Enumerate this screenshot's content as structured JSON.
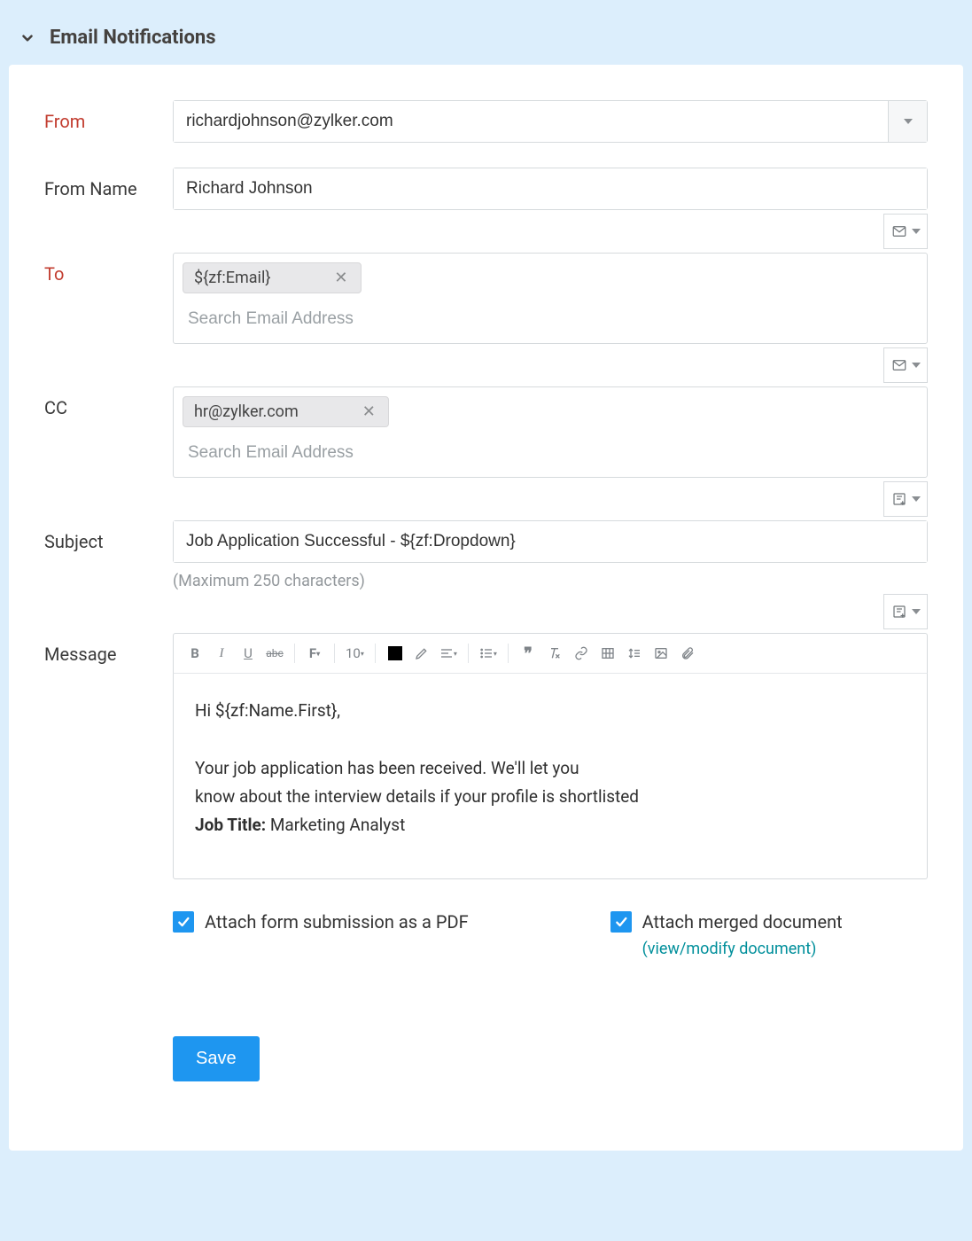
{
  "section_title": "Email Notifications",
  "labels": {
    "from": "From",
    "from_name": "From Name",
    "to": "To",
    "cc": "CC",
    "subject": "Subject",
    "message": "Message"
  },
  "from": {
    "value": "richardjohnson@zylker.com"
  },
  "from_name": {
    "value": "Richard Johnson"
  },
  "to": {
    "chip": "${zf:Email}",
    "placeholder": "Search Email Address"
  },
  "cc": {
    "chip": "hr@zylker.com",
    "placeholder": "Search Email Address"
  },
  "subject": {
    "value": "Job Application Successful - ${zf:Dropdown}",
    "hint": "(Maximum 250 characters)"
  },
  "message": {
    "greeting": "Hi ${zf:Name.First},",
    "body1": "Your job application has been received. We'll let you",
    "body2": "know about the interview details if your profile is shortlisted",
    "job_label": "Job Title:",
    "job_value": " Marketing Analyst"
  },
  "toolbar": {
    "font_size": "10"
  },
  "attach_pdf_label": "Attach form submission as a PDF",
  "attach_merged_label": "Attach merged document",
  "attach_merged_link": "(view/modify document)",
  "save_label": "Save"
}
